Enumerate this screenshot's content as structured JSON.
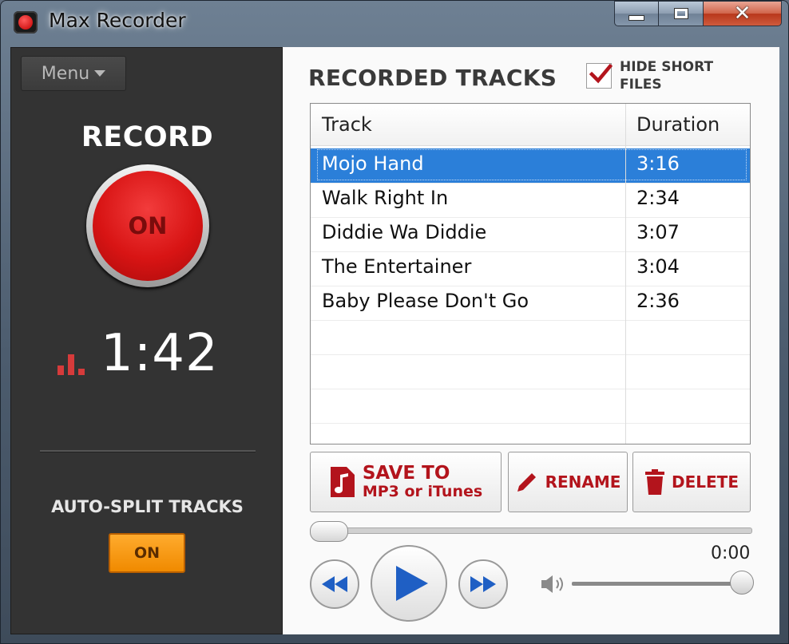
{
  "window": {
    "title": "Max Recorder",
    "icon": "record-dot-icon",
    "controls": {
      "minimize": "minimize-icon",
      "maximize": "maximize-icon",
      "close": "close-icon",
      "close_glyph": "✕"
    }
  },
  "left_panel": {
    "menu_label": "Menu",
    "record_label": "RECORD",
    "record_state": "ON",
    "elapsed_time": "1:42",
    "auto_split_label": "AUTO-SPLIT TRACKS",
    "auto_split_state": "ON",
    "colors": {
      "record": "#d81414",
      "toggle": "#f59500",
      "panel": "#333333"
    }
  },
  "right_panel": {
    "title": "RECORDED TRACKS",
    "hide_short_files": {
      "label": "HIDE SHORT FILES",
      "checked": true
    },
    "table": {
      "columns": [
        "Track",
        "Duration"
      ],
      "rows": [
        {
          "track": "Mojo Hand",
          "duration": "3:16",
          "selected": true
        },
        {
          "track": "Walk Right In",
          "duration": "2:34"
        },
        {
          "track": "Diddie Wa Diddie",
          "duration": "3:07"
        },
        {
          "track": "The Entertainer",
          "duration": "3:04"
        },
        {
          "track": "Baby Please Don't Go",
          "duration": "2:36"
        }
      ]
    },
    "actions": {
      "save_line1": "SAVE TO",
      "save_line2": "MP3 or iTunes",
      "rename": "RENAME",
      "delete": "DELETE"
    },
    "player": {
      "position": "0:00",
      "seek_fraction": 0,
      "volume_fraction": 1,
      "icons": [
        "rewind-icon",
        "play-icon",
        "fast-forward-icon",
        "speaker-icon"
      ]
    },
    "colors": {
      "accent": "#b3141c",
      "selection": "#2b7fd9"
    }
  }
}
